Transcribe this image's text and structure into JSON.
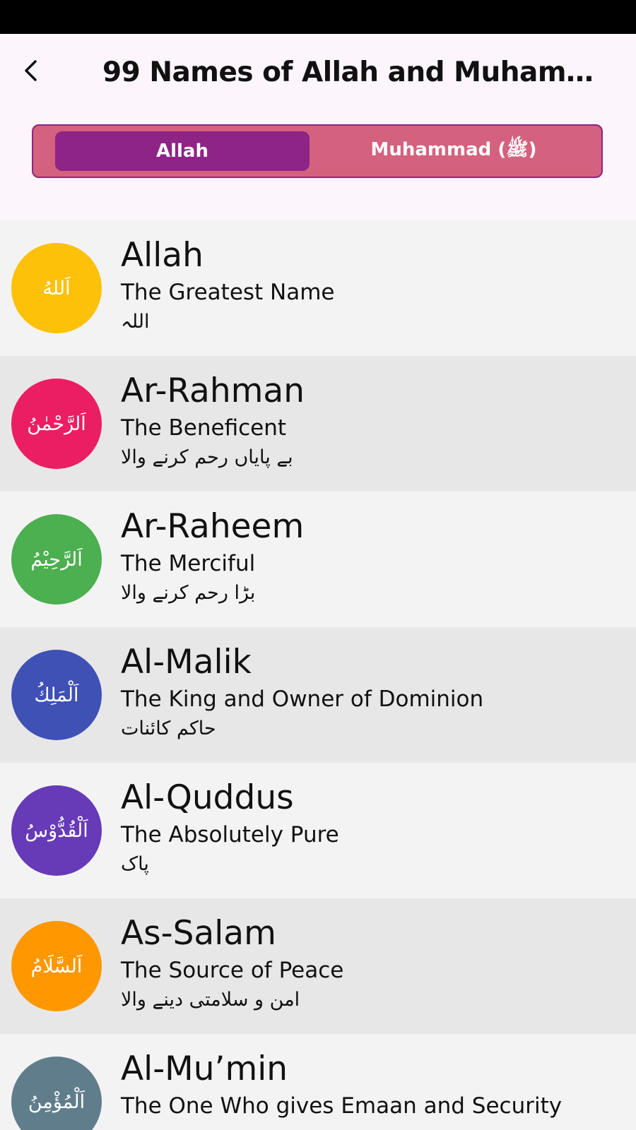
{
  "app_bar": {
    "title": "99 Names of Allah and Muhamma..."
  },
  "tabs": [
    {
      "label": "Allah",
      "selected": true
    },
    {
      "label": "Muhammad (ﷺ)",
      "selected": false
    }
  ],
  "colors": {
    "tab_selected": "#8e2485",
    "tab_background": "#d4617d",
    "row_light": "#f4f3f4",
    "row_dark": "#e8e7e8"
  },
  "names": [
    {
      "arabic": "اَللهُ",
      "name": "Allah",
      "meaning": "The Greatest Name",
      "urdu": "اللہ",
      "color": "#fec10a"
    },
    {
      "arabic": "اَلرَّحْمٰنُ",
      "name": "Ar-Rahman",
      "meaning": "The Beneficent",
      "urdu": "بے پایاں رحم کرنے والا",
      "color": "#eb1e63"
    },
    {
      "arabic": "اَلرَّحِيْمُ",
      "name": "Ar-Raheem",
      "meaning": "The Merciful",
      "urdu": "بڑا رحم کرنے والا",
      "color": "#4caf50"
    },
    {
      "arabic": "اَلْمَلِكُ",
      "name": "Al-Malik",
      "meaning": "The King and Owner of Dominion",
      "urdu": "حاکم کائنات",
      "color": "#3f51b5"
    },
    {
      "arabic": "اَلْقُدُّوْسُ",
      "name": "Al-Quddus",
      "meaning": "The Absolutely Pure",
      "urdu": "پاک",
      "color": "#673ab7"
    },
    {
      "arabic": "اَلسَّلَامُ",
      "name": "As-Salam",
      "meaning": "The Source of Peace",
      "urdu": "امن و سلامتی دینے والا",
      "color": "#ff9800"
    },
    {
      "arabic": "اَلْمُؤْمِنُ",
      "name": "Al-Mu’min",
      "meaning": "The One Who gives Emaan and Security",
      "urdu": "",
      "color": "#607d8b"
    }
  ]
}
